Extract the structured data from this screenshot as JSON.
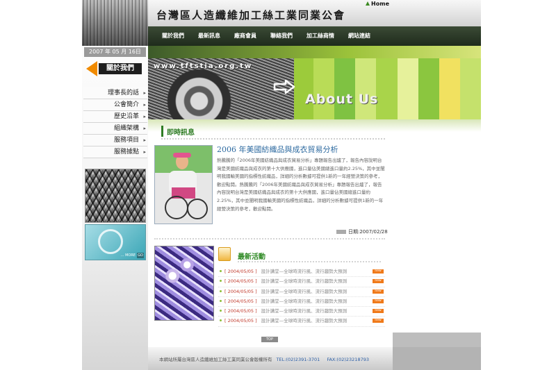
{
  "header": {
    "home_label": "Home",
    "site_title": "台灣區人造纖維加工絲工業同業公會"
  },
  "nav": {
    "items": [
      "關於我們",
      "最新訊息",
      "廠商會員",
      "聯絡我們",
      "加工絲商情",
      "網站連結"
    ]
  },
  "sidebar": {
    "date": "2007 年 05 月 16日",
    "badge_label": "關於我們",
    "items": [
      {
        "label": "理事長的話"
      },
      {
        "label": "公會簡介"
      },
      {
        "label": "歷史沿革"
      },
      {
        "label": "組織架構"
      },
      {
        "label": "服務項目"
      },
      {
        "label": "服務據點"
      }
    ],
    "promo_text": "... MORE",
    "promo_go": "GO"
  },
  "banner": {
    "url": "www.tftstia.org.tw",
    "title": "About Us",
    "stripe_colors": [
      "#9ccb3b",
      "#b9dc57",
      "#7fc242",
      "#cfe77a",
      "#a9d44a",
      "#e6f19b",
      "#8bc63f",
      "#f1e160",
      "#c5e16c"
    ]
  },
  "news": {
    "section_title": "即時訊息",
    "article_title": "2006 年美國紡織品與成衣貿易分析",
    "article_body": "熱騰騰的「2006年美國紡織品與成衣貿易分析」專題報告出爐了，報告內容說明台灣是美國紡織品與成衣的第十大供應國，進口量佔美國總進口量約2.25%，其中並闡明我國輸美國的指標性紡織品，詳細的分析數據可提供1新的一年經營決策的參考，歡迎點閱。熱騰騰的「2006年美國紡織品與成衣貿易分析」專題報告出爐了，報告內容說明台灣是美國紡織品與成衣的第十大供應國，進口量佔美國總進口量約2.25%，其中並闡明我國輸美國的指標性紡織品，詳細的分析數據可提供1新的一年經營決策的參考，歡迎點閱。",
    "date_label": "日期:2007/02/28"
  },
  "events": {
    "section_title": "最新活動",
    "new_badge": "new",
    "items": [
      {
        "date": "[ 2004/05/05 ]",
        "title": "設計講堂—全球時流行風、流行趨勢大預測"
      },
      {
        "date": "[ 2004/05/05 ]",
        "title": "設計講堂—全球時流行風、流行趨勢大預測"
      },
      {
        "date": "[ 2004/05/05 ]",
        "title": "設計講堂—全球時流行風、流行趨勢大預測"
      },
      {
        "date": "[ 2004/05/05 ]",
        "title": "設計講堂—全球時流行風、流行趨勢大預測"
      },
      {
        "date": "[ 2004/05/05 ]",
        "title": "設計講堂—全球時流行風、流行趨勢大預測"
      },
      {
        "date": "[ 2004/05/05 ]",
        "title": "設計講堂—全球時流行風、流行趨勢大預測"
      }
    ]
  },
  "footer": {
    "top_label": "TOP",
    "copyright": "本網站所屬台灣區人造纖維加工絲工業同業公會版權所有",
    "tel": "TEL:(02)2391-3701",
    "fax": "FAX:(02)23218793"
  }
}
